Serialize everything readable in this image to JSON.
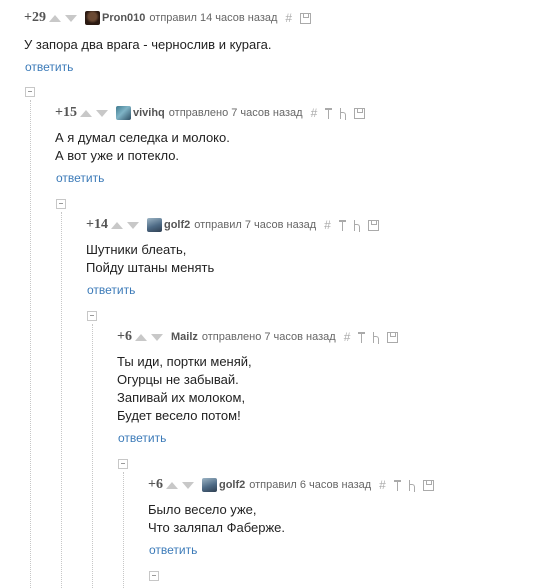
{
  "reply_label": "ответить",
  "comments": [
    {
      "rating": "+29",
      "user": "Pron010",
      "action": "отправил 14 часов назад",
      "lines": [
        "У запора два врага - чернослив и курага."
      ]
    },
    {
      "rating": "+15",
      "user": "vivihq",
      "action": "отправлено 7 часов назад",
      "lines": [
        "А я думал селедка и молоко.",
        "А вот уже и потекло."
      ]
    },
    {
      "rating": "+14",
      "user": "golf2",
      "action": "отправил 7 часов назад",
      "lines": [
        "Шутники блеать,",
        "Пойду штаны менять"
      ]
    },
    {
      "rating": "+6",
      "user": "Mailz",
      "action": "отправлено 7 часов назад",
      "lines": [
        "Ты иди, портки меняй,",
        "Огурцы не забывай.",
        "Запивай их молоком,",
        "Будет весело потом!"
      ]
    },
    {
      "rating": "+6",
      "user": "golf2",
      "action": "отправил 6 часов назад",
      "lines": [
        "Было весело уже,",
        "Что заляпал Фаберже."
      ]
    }
  ],
  "icons": {
    "hash": "#",
    "pin": "pin-icon",
    "parent": "parent-icon",
    "save": "save-icon",
    "collapse": "collapse-icon",
    "vote_up": "arrow-up-icon",
    "vote_down": "arrow-down-icon"
  }
}
